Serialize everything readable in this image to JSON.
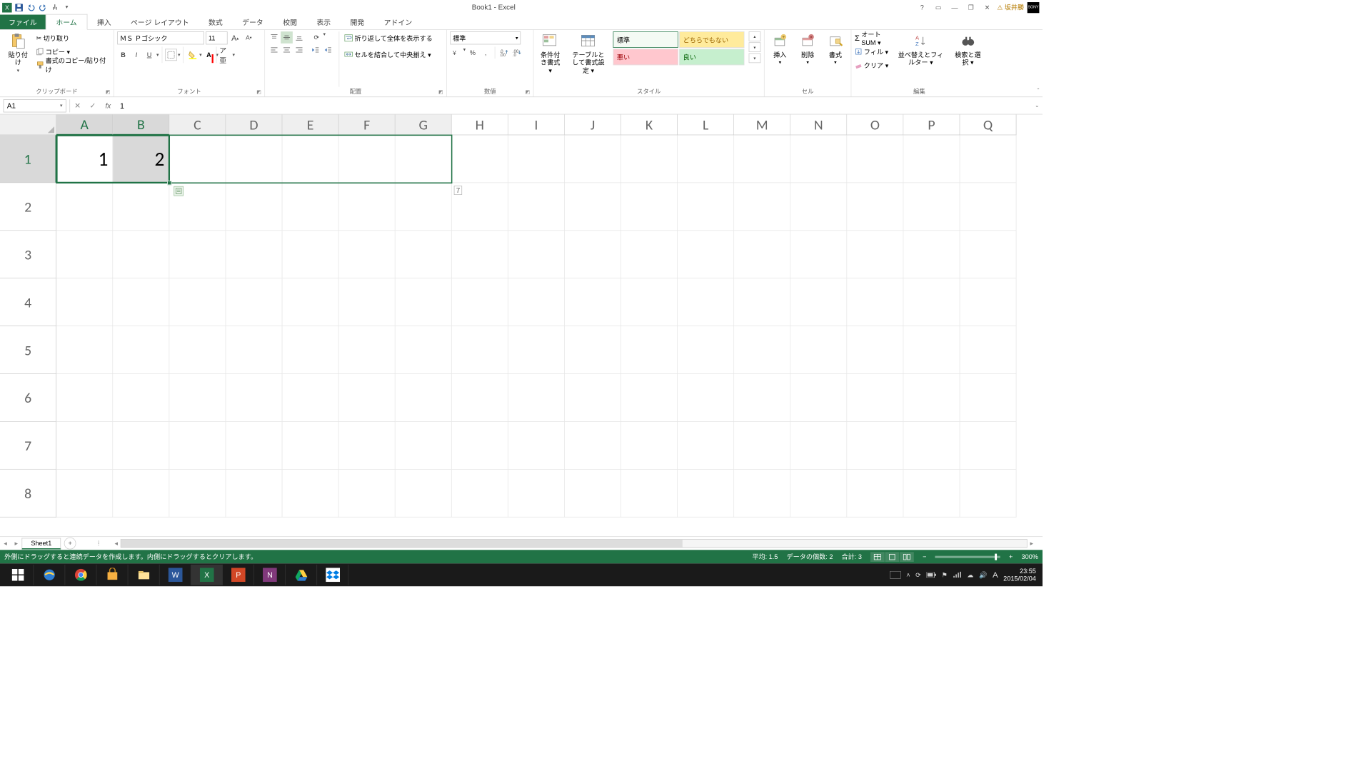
{
  "title": "Book1 - Excel",
  "qat": {
    "save": "",
    "undo": "",
    "redo": ""
  },
  "user": "坂井勝",
  "tabs": {
    "file": "ファイル",
    "home": "ホーム",
    "insert": "挿入",
    "layout": "ページ レイアウト",
    "formulas": "数式",
    "data": "データ",
    "review": "校閲",
    "view": "表示",
    "developer": "開発",
    "addins": "アドイン"
  },
  "ribbon": {
    "clipboard": {
      "label": "クリップボード",
      "paste": "貼り付け",
      "cut": "切り取り",
      "copy": "コピー ▾",
      "fmt": "書式のコピー/貼り付け"
    },
    "font": {
      "label": "フォント",
      "name": "ＭＳ Ｐゴシック",
      "size": "11",
      "bold": "B",
      "italic": "I",
      "underline": "U"
    },
    "align": {
      "label": "配置",
      "wrap": "折り返して全体を表示する",
      "merge": "セルを結合して中央揃え ▾"
    },
    "number": {
      "label": "数値",
      "format": "標準"
    },
    "styles": {
      "label": "スタイル",
      "cond": "条件付き書式 ▾",
      "table": "テーブルとして書式設定 ▾",
      "s1": "標準",
      "s2": "どちらでもない",
      "s3": "悪い",
      "s4": "良い"
    },
    "cells": {
      "label": "セル",
      "insert": "挿入",
      "delete": "削除",
      "format": "書式"
    },
    "editing": {
      "label": "編集",
      "autosum": "オート SUM ▾",
      "fill": "フィル ▾",
      "clear": "クリア ▾",
      "sort": "並べ替えとフィルター ▾",
      "find": "検索と選択 ▾"
    }
  },
  "formula_bar": {
    "name_box": "A1",
    "formula": "1"
  },
  "grid": {
    "cols": [
      "A",
      "B",
      "C",
      "D",
      "E",
      "F",
      "G",
      "H",
      "I",
      "J",
      "K",
      "L",
      "M",
      "N",
      "O",
      "P",
      "Q"
    ],
    "rows": [
      "1",
      "2",
      "3",
      "4",
      "5",
      "6",
      "7",
      "8"
    ],
    "A1": "1",
    "B1": "2",
    "drag_hint": "7"
  },
  "sheet": {
    "name": "Sheet1"
  },
  "status": {
    "msg": "外側にドラッグすると連続データを作成します。内側にドラッグするとクリアします。",
    "avg": "平均: 1.5",
    "count": "データの個数: 2",
    "sum": "合計: 3",
    "zoom": "300%"
  },
  "taskbar": {
    "time": "23:55",
    "date": "2015/02/04"
  }
}
